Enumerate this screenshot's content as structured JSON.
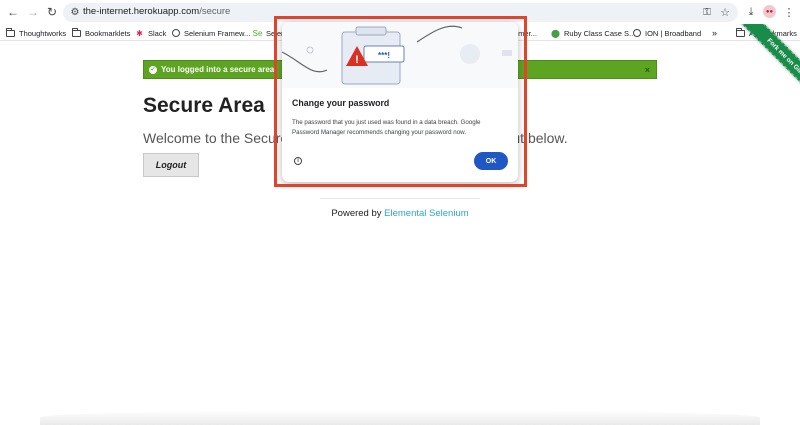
{
  "browser": {
    "url_host": "the-internet.herokuapp.com",
    "url_path": "/secure",
    "icons": {
      "back": "arrow-left-icon",
      "forward": "arrow-right-icon",
      "reload": "reload-icon",
      "site_info": "tune-icon",
      "password_key": "key-icon",
      "bookmark_star": "star-icon",
      "downloads": "download-icon",
      "profile": "avatar",
      "menu": "kebab-menu-icon"
    },
    "avatar_text": "●●"
  },
  "bookmarks": {
    "items": [
      {
        "label": "Thoughtworks",
        "icon": "folder-icon"
      },
      {
        "label": "Bookmarklets",
        "icon": "folder-icon"
      },
      {
        "label": "Slack",
        "icon": "slack-icon"
      },
      {
        "label": "Selenium Framew...",
        "icon": "globe-icon"
      },
      {
        "label": "Selen",
        "icon": "selenium-icon"
      },
      {
        "label": "pmer...",
        "icon": "globe-icon"
      },
      {
        "label": "Ruby Class Case S...",
        "icon": "ruby-icon"
      },
      {
        "label": "ION | Broadband",
        "icon": "globe-icon"
      }
    ],
    "overflow_label": "»",
    "all_bookmarks_label": "All Bookmarks"
  },
  "page": {
    "flash_message": "You logged into a secure area!",
    "flash_close": "×",
    "heading": "Secure Area",
    "subheader": "Welcome to the Secure Area. When you are done click logout below.",
    "logout_label": "Logout",
    "footer_prefix": "Powered by ",
    "footer_link": "Elemental Selenium",
    "ribbon_text": "Fork me on GitHub"
  },
  "dialog": {
    "title": "Change your password",
    "body": "The password that you just used was found in a data breach. Google Password Manager recommends changing your password now.",
    "ok_label": "OK",
    "info_glyph": "i",
    "illustration_text": "***!"
  },
  "colors": {
    "flash_green": "#5da423",
    "ok_blue": "#1f57c3",
    "highlight_red": "#e0442c",
    "link_blue": "#2ba6cb",
    "ribbon_green": "#1a8c4a"
  }
}
